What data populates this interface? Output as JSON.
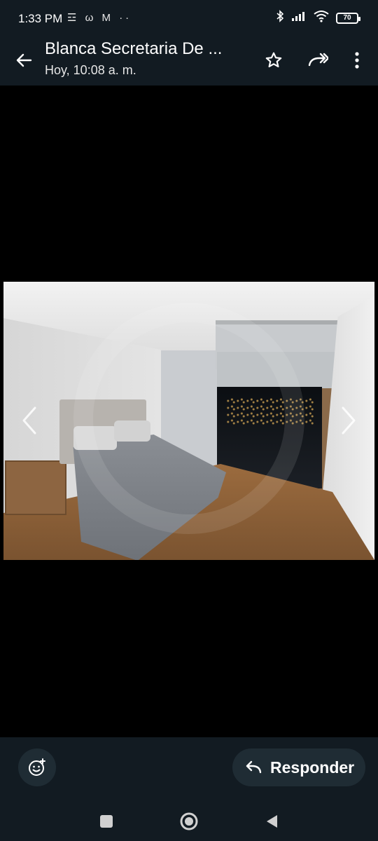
{
  "status_bar": {
    "time": "1:33 PM",
    "notification_icons": [
      "☲",
      "ω",
      "M",
      "··"
    ],
    "battery": "70"
  },
  "header": {
    "title": "Blanca Secretaria De ...",
    "subtitle": "Hoy, 10:08 a. m."
  },
  "footer": {
    "reply_label": "Responder"
  },
  "colors": {
    "bar_background": "#121b22",
    "button_background": "#1f2c34"
  }
}
